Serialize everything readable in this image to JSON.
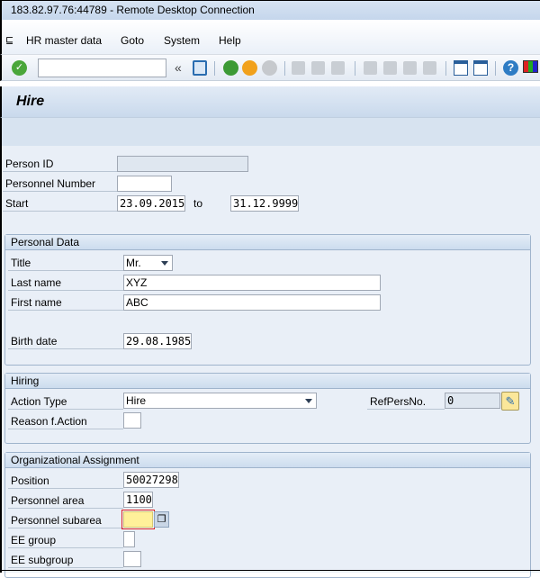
{
  "window": {
    "title": "183.82.97.76:44789 - Remote Desktop Connection"
  },
  "menu": [
    {
      "label": "HR master data"
    },
    {
      "label": "Goto"
    },
    {
      "label": "System"
    },
    {
      "label": "Help"
    }
  ],
  "toolbar": {
    "command_field": "",
    "icons": [
      "check-icon",
      "back-icon",
      "save-icon",
      "back-green-icon",
      "exit-icon",
      "cancel-icon",
      "print-icon",
      "find-icon",
      "find-next-icon",
      "first-page-icon",
      "prev-page-icon",
      "next-page-icon",
      "last-page-icon",
      "new-session-icon",
      "shortcut-icon",
      "help-icon",
      "customize-layout-icon"
    ]
  },
  "header": {
    "title": "Hire"
  },
  "top": {
    "person_id_label": "Person ID",
    "person_id": "",
    "pernr_label": "Personnel Number",
    "pernr": "",
    "start_label": "Start",
    "start": "23.09.2015",
    "to_label": "to",
    "end": "31.12.9999"
  },
  "personal": {
    "title": "Personal Data",
    "title_label": "Title",
    "title_value": "Mr.",
    "last_label": "Last name",
    "last": "XYZ",
    "first_label": "First name",
    "first": "ABC",
    "birth_label": "Birth date",
    "birth": "29.08.1985"
  },
  "hiring": {
    "title": "Hiring",
    "action_label": "Action Type",
    "action": "Hire",
    "ref_label": "RefPersNo.",
    "ref": "0",
    "reason_label": "Reason f.Action",
    "reason": ""
  },
  "org": {
    "title": "Organizational Assignment",
    "position_label": "Position",
    "position": "50027298",
    "area_label": "Personnel area",
    "area": "1100",
    "subarea_label": "Personnel subarea",
    "subarea": "",
    "group_label": "EE group",
    "group": "",
    "subgroup_label": "EE subgroup",
    "subgroup": ""
  }
}
